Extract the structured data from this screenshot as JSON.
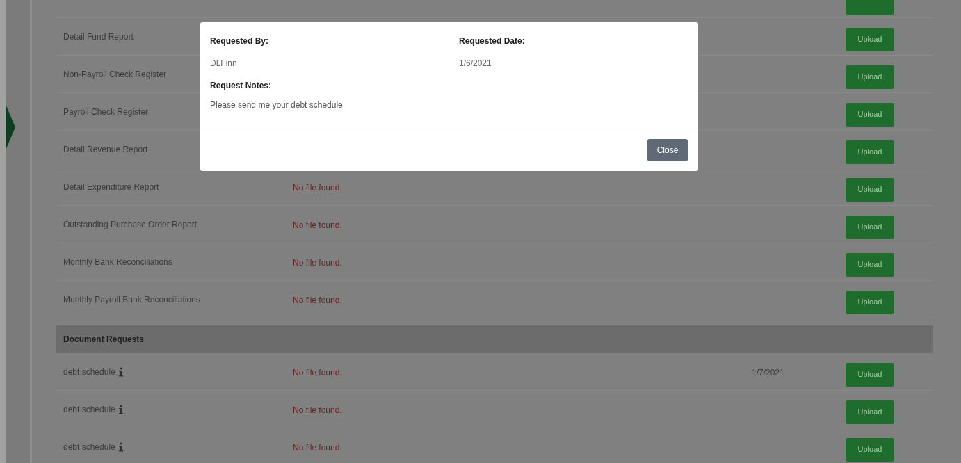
{
  "reports": [
    {
      "name": "Detail Fund Report",
      "action": "Upload"
    },
    {
      "name": "Non-Payroll Check Register",
      "action": "Upload"
    },
    {
      "name": "Payroll Check Register",
      "action": "Upload"
    },
    {
      "name": "Detail Revenue Report",
      "action": "Upload"
    },
    {
      "name": "Detail Expenditure Report",
      "status": "No file found.",
      "action": "Upload"
    },
    {
      "name": "Outstanding Purchase Order Report",
      "status": "No file found.",
      "action": "Upload"
    },
    {
      "name": "Monthly Bank Reconciliations",
      "status": "No file found.",
      "action": "Upload"
    },
    {
      "name": "Monthly Payroll Bank Reconciliations",
      "status": "No file found.",
      "action": "Upload"
    }
  ],
  "section_title": "Document Requests",
  "requests": [
    {
      "name": "debt schedule",
      "status": "No file found.",
      "date": "1/7/2021",
      "action": "Upload"
    },
    {
      "name": "debt schedule",
      "status": "No file found.",
      "action": "Upload"
    },
    {
      "name": "debt schedule",
      "status": "No file found.",
      "action": "Upload"
    }
  ],
  "modal": {
    "requested_by_label": "Requested By:",
    "requested_by": "DLFinn",
    "requested_date_label": "Requested Date:",
    "requested_date": "1/6/2021",
    "notes_label": "Request Notes:",
    "notes": "Please send me your debt schedule",
    "close": "Close"
  }
}
